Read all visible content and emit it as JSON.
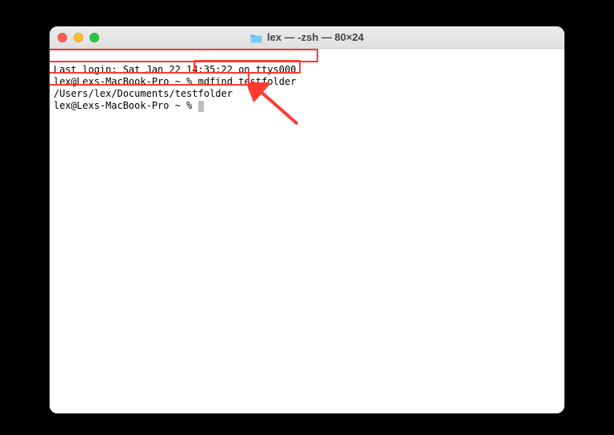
{
  "window": {
    "title": "lex — -zsh — 80×24"
  },
  "terminal": {
    "line1": "Last login: Sat Jan 22 14:35:22 on ttys000",
    "prompt": "lex@Lexs-MacBook-Pro ~ % ",
    "command": "mdfind testfolder",
    "output": "/Users/lex/Documents/testfolder",
    "prompt2": "lex@Lexs-MacBook-Pro ~ % "
  },
  "annotations": {
    "highlight_color": "#ff3b30",
    "arrow_color": "#ff3b30"
  }
}
